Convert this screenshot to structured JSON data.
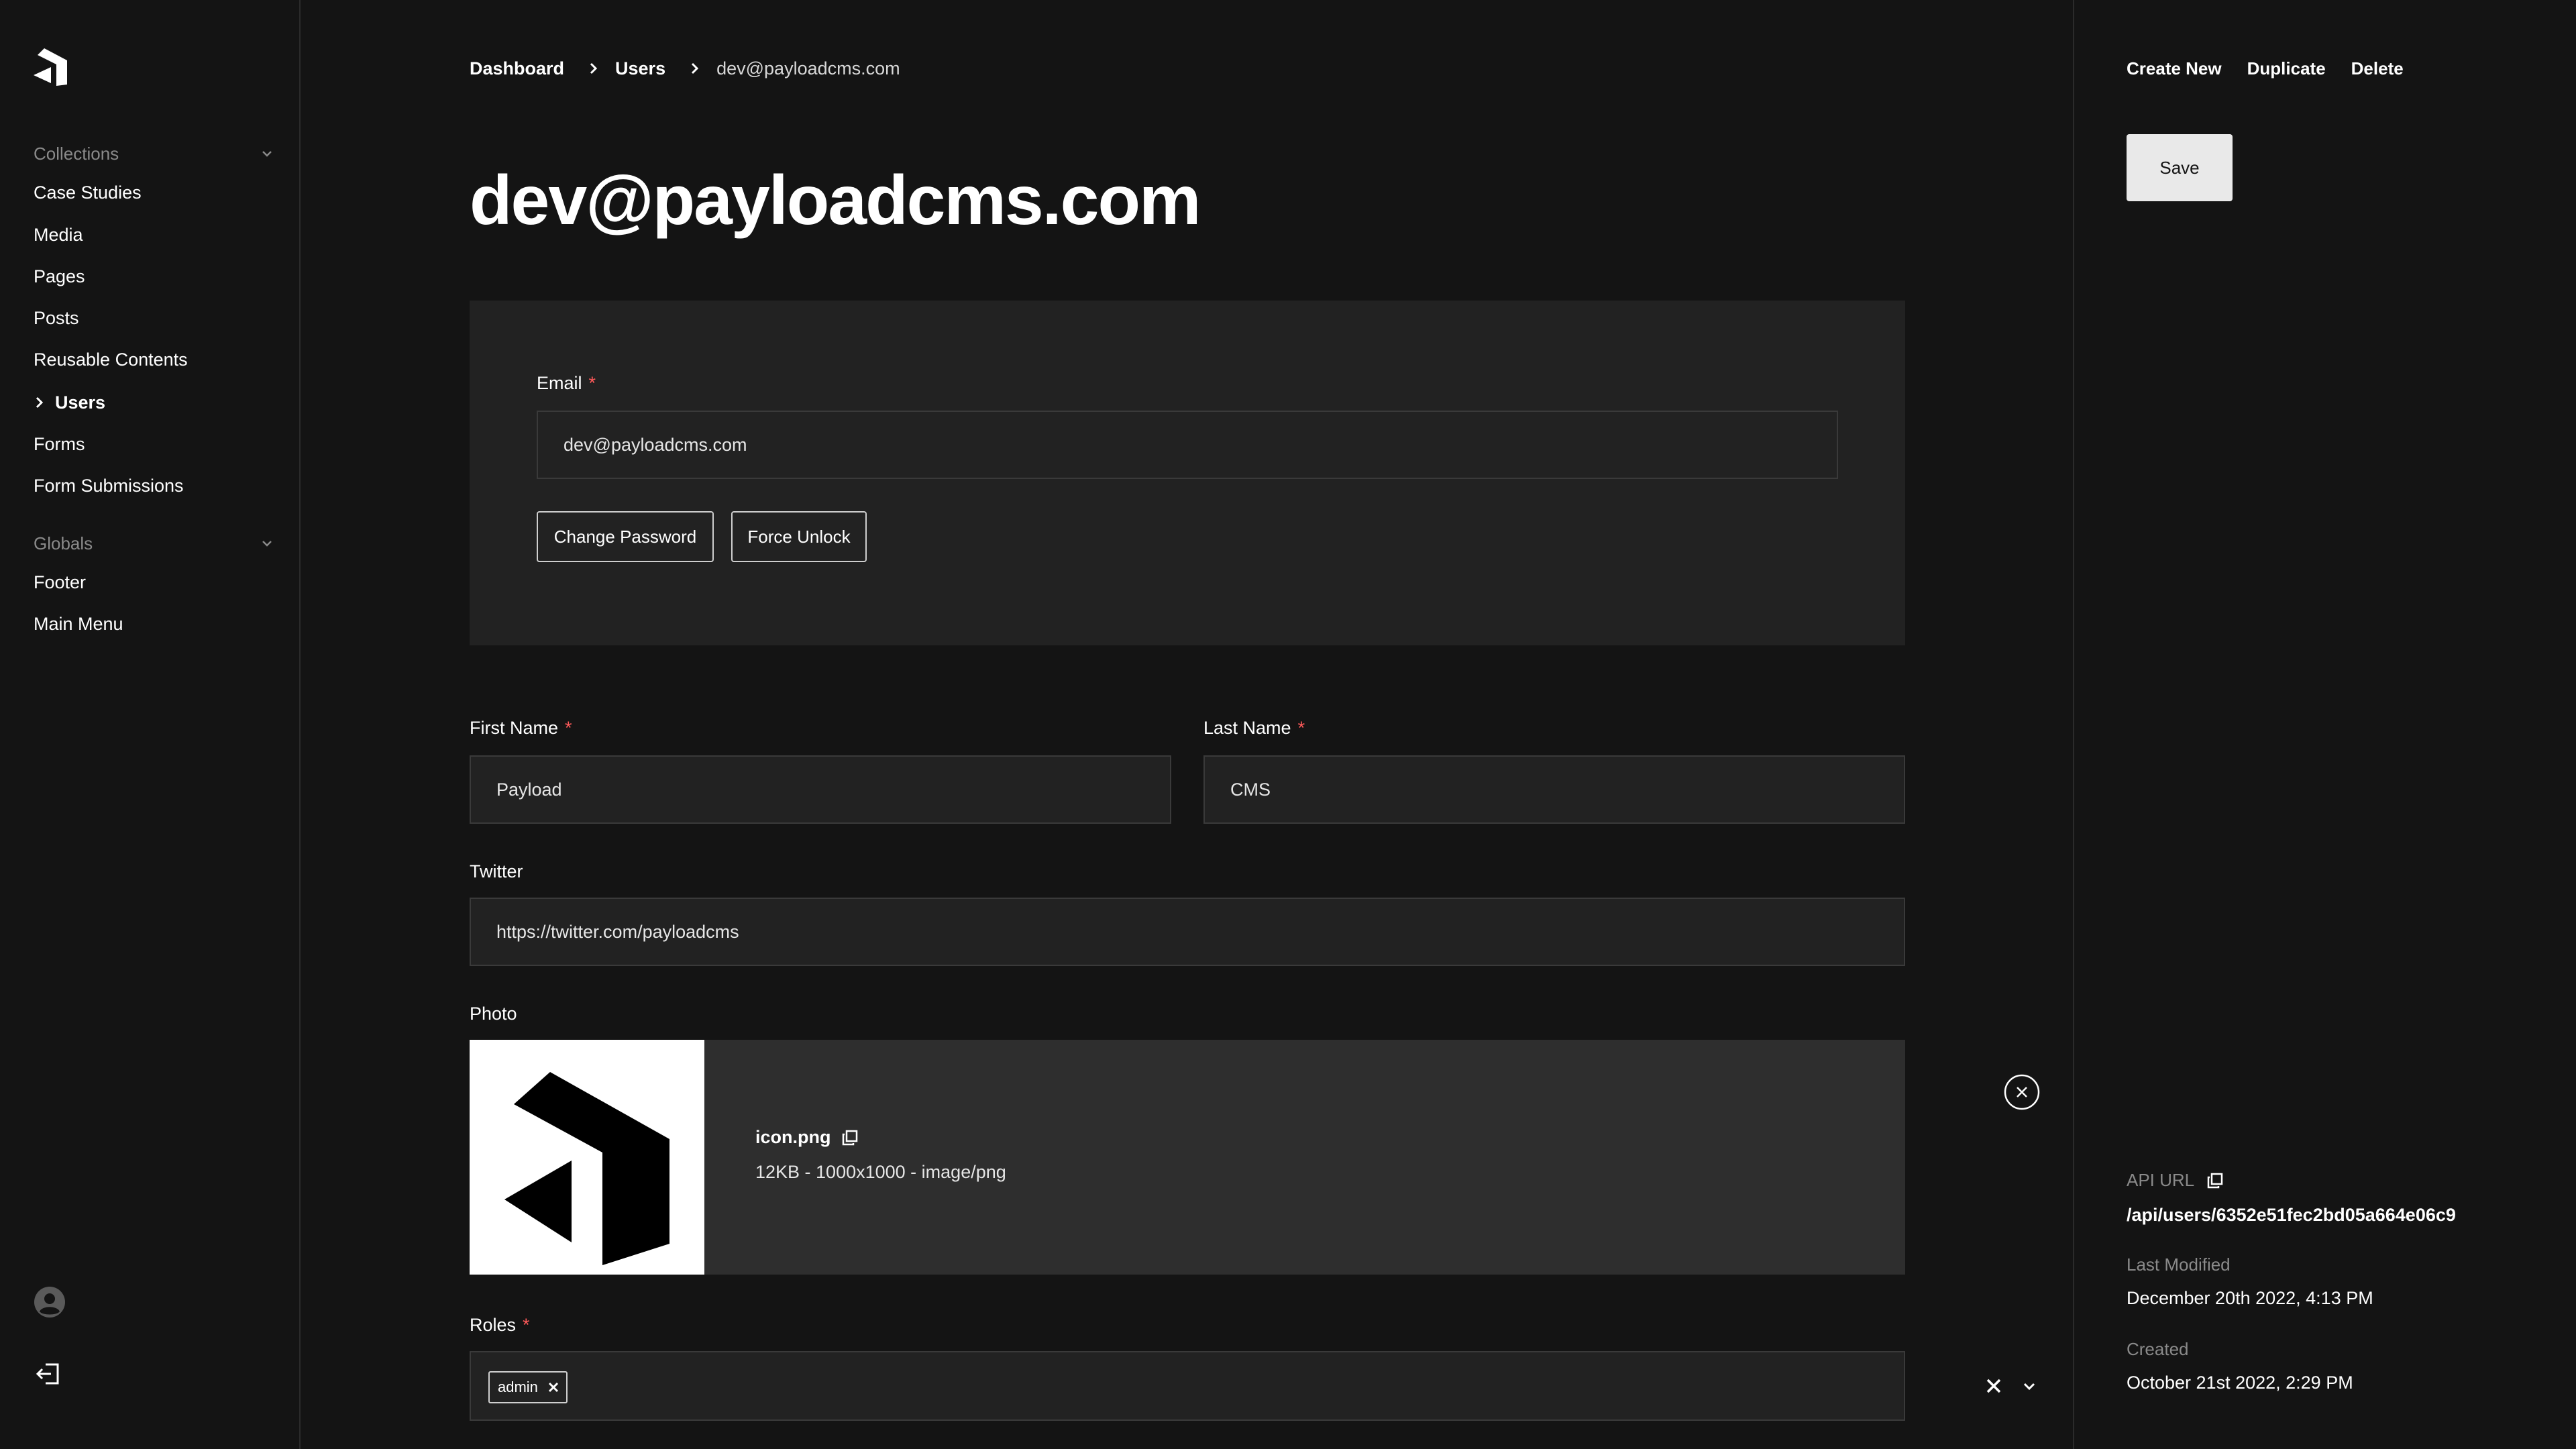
{
  "sidebar": {
    "collections_title": "Collections",
    "collections": [
      {
        "label": "Case Studies"
      },
      {
        "label": "Media"
      },
      {
        "label": "Pages"
      },
      {
        "label": "Posts"
      },
      {
        "label": "Reusable Contents"
      },
      {
        "label": "Users",
        "active": true
      },
      {
        "label": "Forms"
      },
      {
        "label": "Form Submissions"
      }
    ],
    "globals_title": "Globals",
    "globals": [
      {
        "label": "Footer"
      },
      {
        "label": "Main Menu"
      }
    ]
  },
  "breadcrumb": {
    "dashboard": "Dashboard",
    "users": "Users",
    "current": "dev@payloadcms.com"
  },
  "page_title": "dev@payloadcms.com",
  "auth": {
    "email_label": "Email",
    "email_required": "*",
    "email_value": "dev@payloadcms.com",
    "change_password": "Change Password",
    "force_unlock": "Force Unlock"
  },
  "fields": {
    "first_name_label": "First Name",
    "first_name_value": "Payload",
    "last_name_label": "Last Name",
    "last_name_value": "CMS",
    "required_mark": "*",
    "twitter_label": "Twitter",
    "twitter_value": "https://twitter.com/payloadcms",
    "photo_label": "Photo",
    "photo_filename": "icon.png",
    "photo_meta": "12KB - 1000x1000 - image/png",
    "roles_label": "Roles",
    "roles_selected": "admin"
  },
  "doc_controls": {
    "create_new": "Create New",
    "duplicate": "Duplicate",
    "delete": "Delete",
    "save": "Save"
  },
  "meta": {
    "api_url_label": "API URL",
    "api_url_value": "/api/users/6352e51fec2bd05a664e06c9",
    "last_modified_label": "Last Modified",
    "last_modified_value": "December 20th 2022, 4:13 PM",
    "created_label": "Created",
    "created_value": "October 21st 2022, 2:29 PM"
  },
  "colors": {
    "background": "#141414",
    "surface": "#222222",
    "required": "#ff5a5a"
  }
}
